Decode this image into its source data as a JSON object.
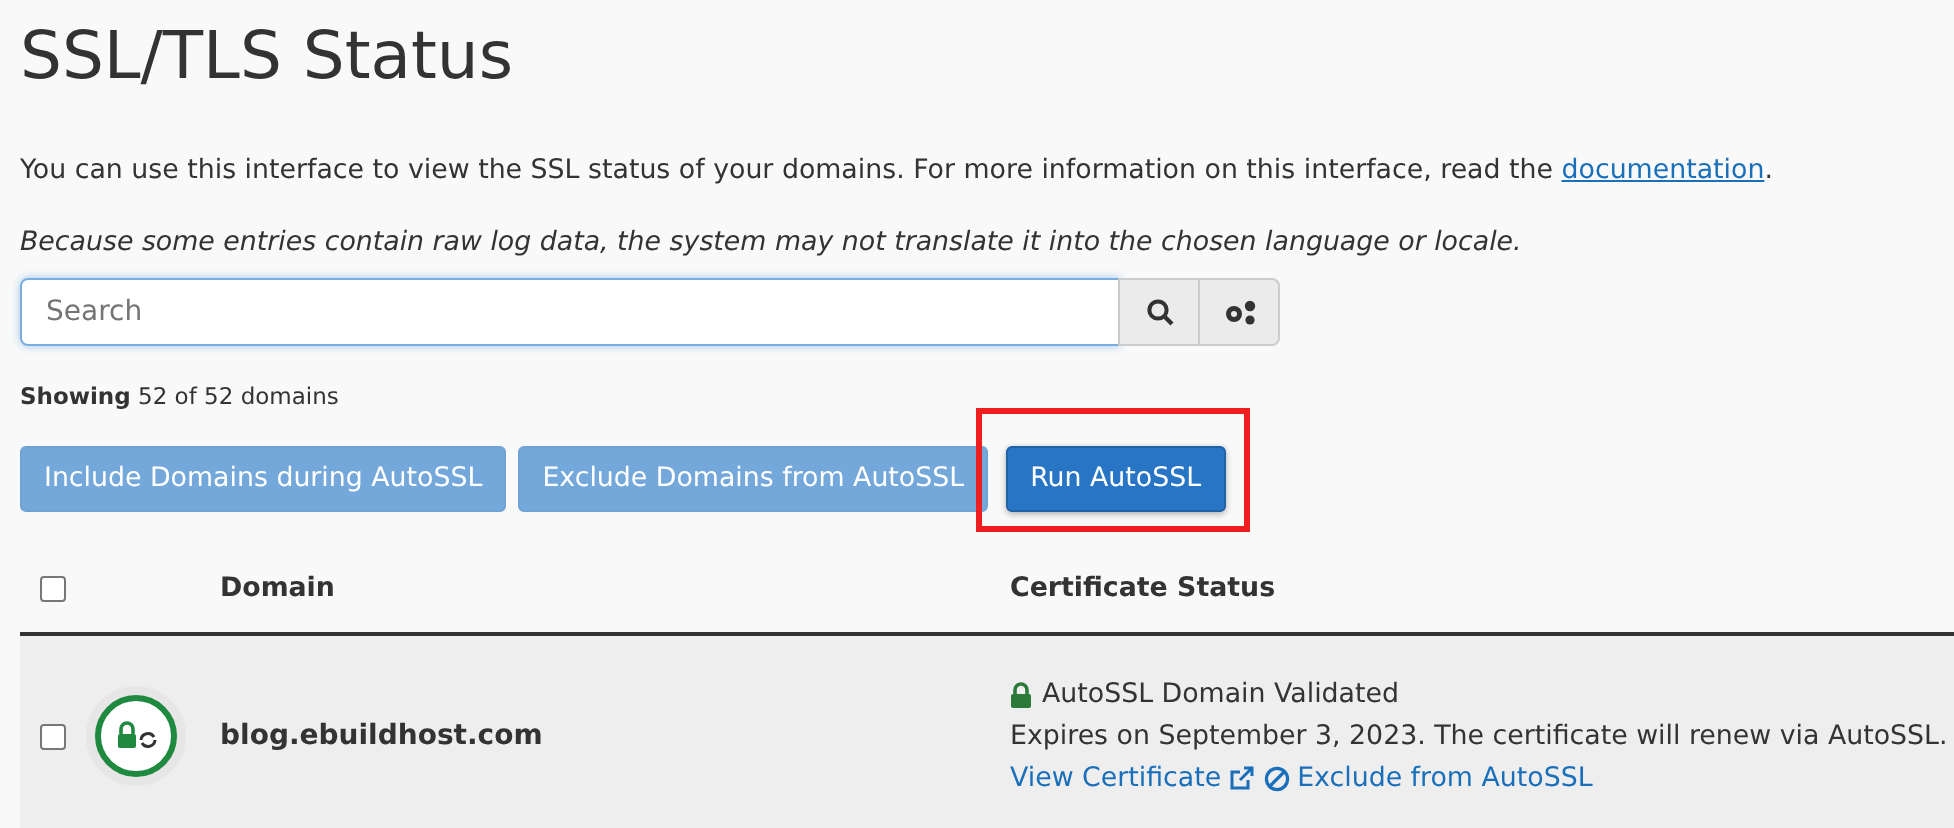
{
  "title": "SSL/TLS Status",
  "intro": {
    "text": "You can use this interface to view the SSL status of your domains. For more information on this interface, read the ",
    "link": "documentation",
    "end": "."
  },
  "note": "Because some entries contain raw log data, the system may not translate it into the chosen language or locale.",
  "search": {
    "placeholder": "Search"
  },
  "showing": "**Showing** 52 of 52 domains",
  "buttons": [
    {
      "label": "Include Domains during AutoSSL",
      "kind": "secondary",
      "highlighted": false
    },
    {
      "label": "Exclude Domains from AutoSSL",
      "kind": "secondary",
      "highlighted": false
    },
    {
      "label": "Run AutoSSL",
      "kind": "primary",
      "highlighted": true
    }
  ],
  "table": {
    "select_all": {
      "checked": false
    },
    "columns": [
      "Domain",
      "Certificate Status"
    ],
    "rows": [
      {
        "checked": false,
        "domain": "blog.ebuildhost.com",
        "status": "AutoSSL Domain Validated",
        "expiry": "Expires on September 3, 2023. The certificate will renew via AutoSSL.",
        "actions": [
          {
            "label": "View Certificate",
            "kind": "view"
          },
          {
            "label": "Exclude from AutoSSL",
            "kind": "exclude"
          }
        ]
      }
    ]
  }
}
